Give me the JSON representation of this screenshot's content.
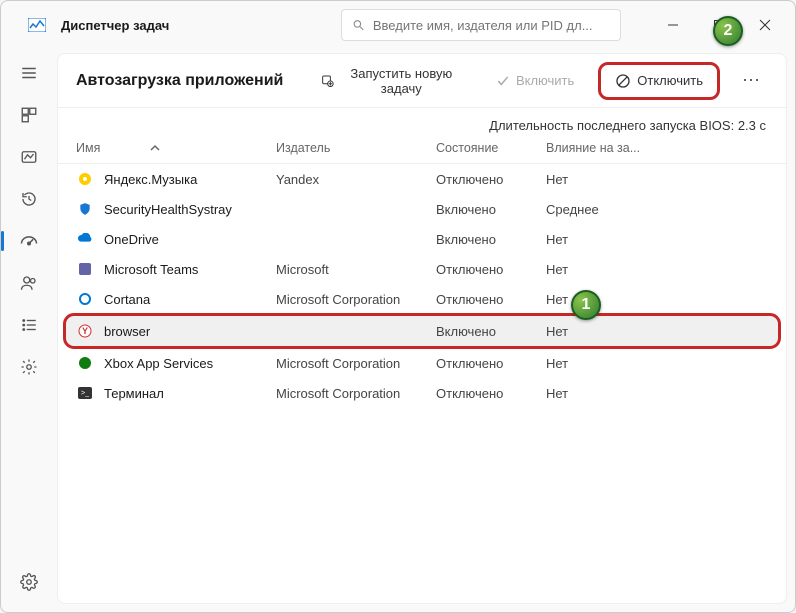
{
  "app": {
    "title": "Диспетчер задач"
  },
  "search": {
    "placeholder": "Введите имя, издателя или PID дл..."
  },
  "page": {
    "title": "Автозагрузка приложений",
    "new_task": "Запустить новую задачу",
    "enable": "Включить",
    "disable": "Отключить",
    "bios": "Длительность последнего запуска BIOS: 2.3 с"
  },
  "headers": {
    "name": "Имя",
    "publisher": "Издатель",
    "state": "Состояние",
    "impact": "Влияние на за..."
  },
  "rows": [
    {
      "name": "Яндекс.Музыка",
      "publisher": "Yandex",
      "state": "Отключено",
      "impact": "Нет",
      "icon": "yandex-music"
    },
    {
      "name": "SecurityHealthSystray",
      "publisher": "",
      "state": "Включено",
      "impact": "Среднее",
      "icon": "shield"
    },
    {
      "name": "OneDrive",
      "publisher": "",
      "state": "Включено",
      "impact": "Нет",
      "icon": "onedrive"
    },
    {
      "name": "Microsoft Teams",
      "publisher": "Microsoft",
      "state": "Отключено",
      "impact": "Нет",
      "icon": "teams"
    },
    {
      "name": "Cortana",
      "publisher": "Microsoft Corporation",
      "state": "Отключено",
      "impact": "Нет",
      "icon": "cortana"
    },
    {
      "name": "browser",
      "publisher": "",
      "state": "Включено",
      "impact": "Нет",
      "icon": "ybrowser",
      "hl": true
    },
    {
      "name": "Xbox App Services",
      "publisher": "Microsoft Corporation",
      "state": "Отключено",
      "impact": "Нет",
      "icon": "xbox"
    },
    {
      "name": "Терминал",
      "publisher": "Microsoft Corporation",
      "state": "Отключено",
      "impact": "Нет",
      "icon": "terminal"
    }
  ],
  "badges": {
    "one": "1",
    "two": "2"
  }
}
